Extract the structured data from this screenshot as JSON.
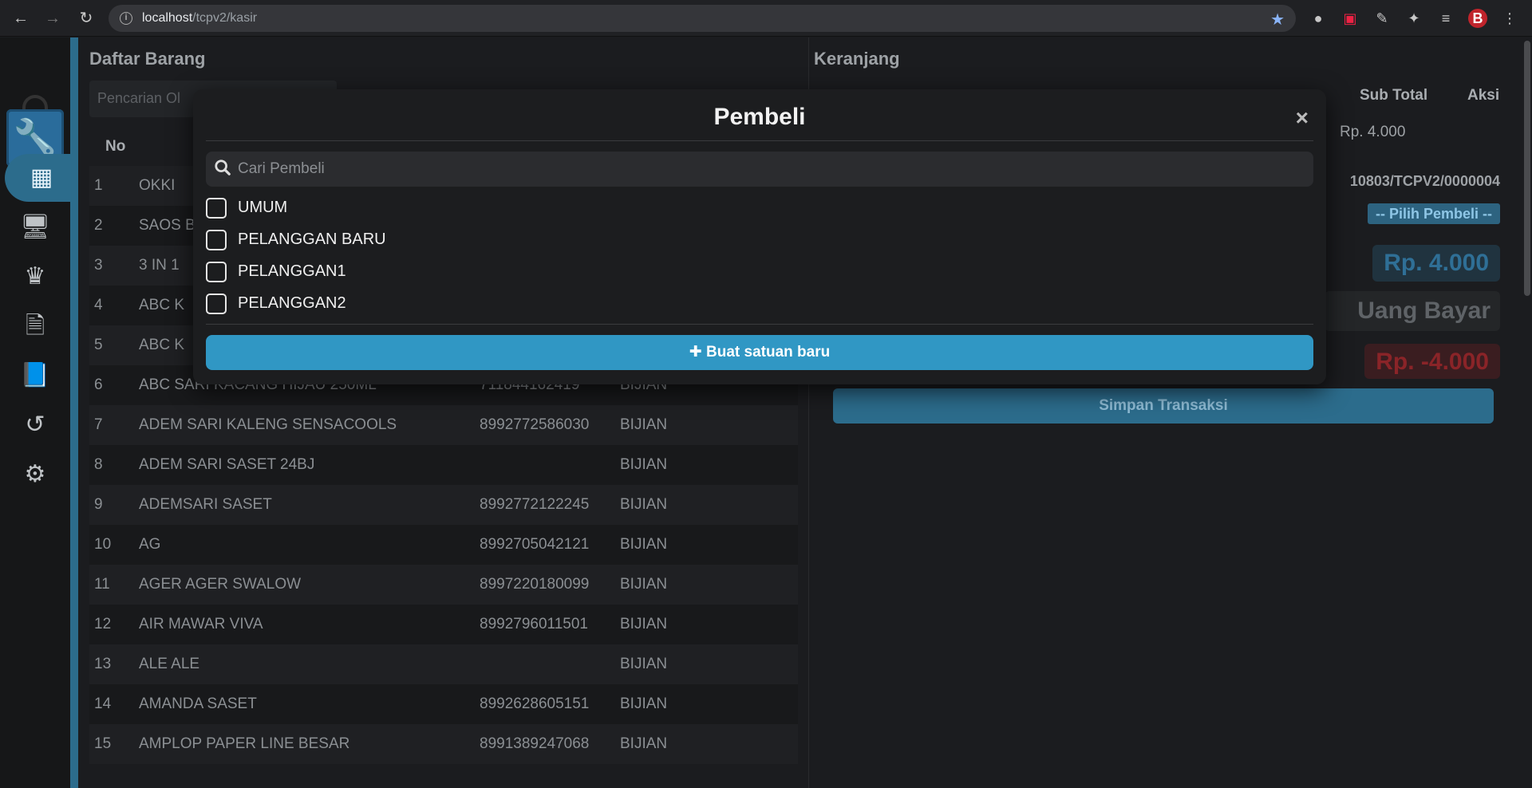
{
  "browser": {
    "url_host": "localhost",
    "url_path": "/tcpv2/kasir"
  },
  "left_panel": {
    "title": "Daftar Barang",
    "search_placeholder": "Pencarian Ol",
    "col_no": "No",
    "rows": [
      {
        "no": "1",
        "name": "OKKI",
        "code": "",
        "unit": ""
      },
      {
        "no": "2",
        "name": "SAOS BK",
        "code": "",
        "unit": ""
      },
      {
        "no": "3",
        "name": "3 IN 1",
        "code": "",
        "unit": ""
      },
      {
        "no": "4",
        "name": "ABC K",
        "code": "",
        "unit": ""
      },
      {
        "no": "5",
        "name": "ABC K",
        "code": "",
        "unit": ""
      },
      {
        "no": "6",
        "name": "ABC SARI KACANG HIJAU 250ML",
        "code": "711844162419",
        "unit": "BIJIAN"
      },
      {
        "no": "7",
        "name": "ADEM SARI KALENG SENSACOOLS",
        "code": "8992772586030",
        "unit": "BIJIAN"
      },
      {
        "no": "8",
        "name": "ADEM SARI SASET 24BJ",
        "code": "",
        "unit": "BIJIAN"
      },
      {
        "no": "9",
        "name": "ADEMSARI SASET",
        "code": "8992772122245",
        "unit": "BIJIAN"
      },
      {
        "no": "10",
        "name": "AG",
        "code": "8992705042121",
        "unit": "BIJIAN"
      },
      {
        "no": "11",
        "name": "AGER AGER SWALOW",
        "code": "8997220180099",
        "unit": "BIJIAN"
      },
      {
        "no": "12",
        "name": "AIR MAWAR VIVA",
        "code": "8992796011501",
        "unit": "BIJIAN"
      },
      {
        "no": "13",
        "name": "ALE ALE",
        "code": "",
        "unit": "BIJIAN"
      },
      {
        "no": "14",
        "name": "AMANDA SASET",
        "code": "8992628605151",
        "unit": "BIJIAN"
      },
      {
        "no": "15",
        "name": "AMPLOP PAPER LINE BESAR",
        "code": "8991389247068",
        "unit": "BIJIAN"
      }
    ]
  },
  "right_panel": {
    "title": "Keranjang",
    "col_subtotal": "Sub Total",
    "col_aksi": "Aksi",
    "subtotal_value": "Rp. 4.000",
    "invoice": "10803/TCPV2/0000004",
    "pilih_pembeli": "-- Pilih Pembeli --",
    "total": "Rp. 4.000",
    "uang_bayar_placeholder": "Uang Bayar",
    "kembalian": "Rp. -4.000",
    "simpan": "Simpan Transaksi"
  },
  "modal": {
    "title": "Pembeli",
    "close": "×",
    "search_placeholder": "Cari Pembeli",
    "options": [
      "UMUM",
      "PELANGGAN BARU",
      "PELANGGAN1",
      "PELANGGAN2"
    ],
    "create_button": "Buat satuan baru"
  },
  "colors": {
    "accent": "#2c6c8c",
    "button_blue": "#3097c4",
    "danger": "#8a2428"
  }
}
